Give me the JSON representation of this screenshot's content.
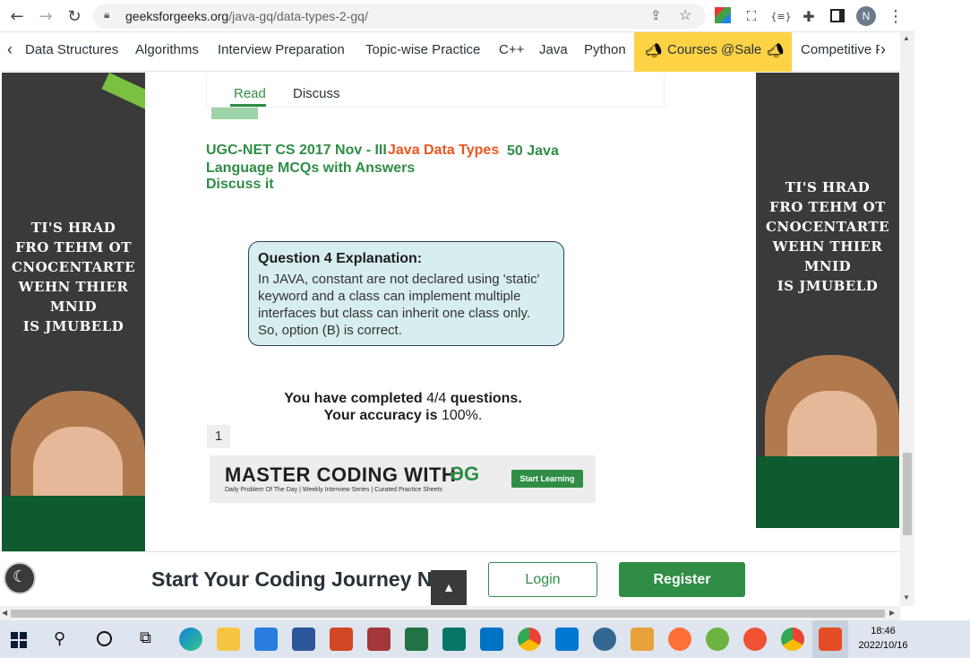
{
  "browser": {
    "url_domain": "geeksforgeeks.org",
    "url_path": "/java-gq/data-types-2-gq/",
    "avatar_initial": "N"
  },
  "site_nav": {
    "items": [
      "Data Structures",
      "Algorithms",
      "Interview Preparation",
      "Topic-wise Practice",
      "C++",
      "Java",
      "Python"
    ],
    "courses_sale": "Courses @Sale",
    "competitive": "Competitive P"
  },
  "article_tabs": {
    "read": "Read",
    "discuss": "Discuss"
  },
  "links": {
    "ugc": "UGC-NET CS 2017 Nov - III",
    "java_data_types": "Java Data Types",
    "mcq": "50 Java Language MCQs with Answers",
    "discuss": "Discuss it"
  },
  "explanation": {
    "title": "Question 4 Explanation:",
    "body": "In JAVA, constant are not declared using 'static' keyword and a class can implement multiple interfaces but class can inherit one class only. So, option (B) is correct."
  },
  "results": {
    "completed_prefix": "You have completed",
    "completed_value": "4/4",
    "completed_suffix": "questions.",
    "accuracy_prefix": "Your accuracy is",
    "accuracy_value": "100%."
  },
  "page_number": "1",
  "banner": {
    "headline": "MASTER CODING WITH",
    "sub": "Daily Problem Of The Day | Weekly Interview Series | Curated Practice Sheets",
    "cta": "Start Learning"
  },
  "ad": {
    "text_lines": [
      "TI'S HRAD",
      "FRO TEHM OT",
      "CNOCENTARTE",
      "WEHN THIER MNID",
      "IS JMUBELD"
    ]
  },
  "bottom_bar": {
    "headline": "Start Your Coding Journey Now!",
    "login": "Login",
    "register": "Register"
  },
  "taskbar": {
    "time": "18:46",
    "date": "2022/10/16"
  },
  "colors": {
    "gfg_green": "#2f8d46",
    "link_orange": "#e8561f",
    "sale_yellow": "#fdd245",
    "explain_bg": "#d7eef0"
  }
}
